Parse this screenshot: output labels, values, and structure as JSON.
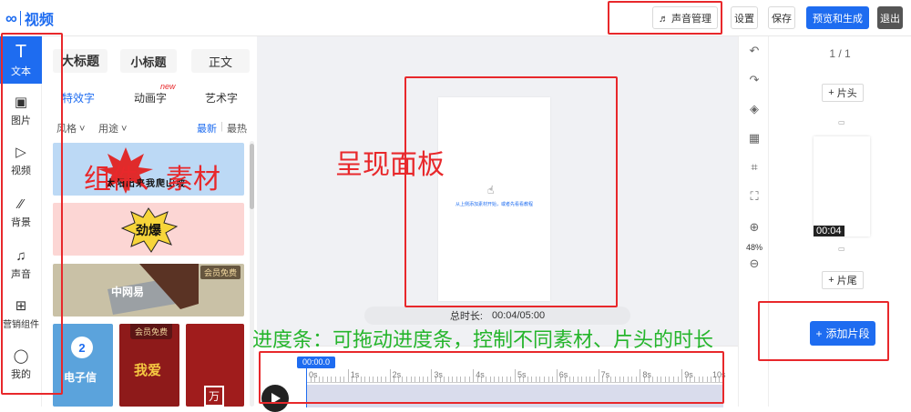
{
  "app": {
    "logo_mark": "∞",
    "logo_text": "视频"
  },
  "header": {
    "sound_button": "♬ 声音管理",
    "settings": "设置",
    "save": "保存",
    "preview": "预览和生成",
    "exit": "退出"
  },
  "nav": {
    "items": [
      {
        "label": "文本",
        "icon": "T"
      },
      {
        "label": "图片",
        "icon": "▣"
      },
      {
        "label": "视频",
        "icon": "▷"
      },
      {
        "label": "背景",
        "icon": "⁄⁄"
      },
      {
        "label": "声音",
        "icon": "♫"
      },
      {
        "label": "营销组件",
        "icon": "⊞"
      },
      {
        "label": "我的",
        "icon": "◯"
      }
    ]
  },
  "panel": {
    "title_tabs": [
      "大标题",
      "小标题",
      "正文"
    ],
    "subtabs": [
      "特效字",
      "动画字",
      "艺术字"
    ],
    "new_badge": "new",
    "filters": {
      "style": "风格 ˅",
      "usage": "用途 ˅",
      "latest": "最新",
      "hottest": "最热"
    },
    "cards": {
      "sun_text": "太阳出来我爬山坡",
      "boom": "劲爆",
      "member": "会员免费",
      "china": "中网易",
      "digit": "2",
      "electronic": "电子信",
      "wo_ai": "我爱",
      "wan": "万"
    }
  },
  "canvas": {
    "hint": "从上侧添加素材开始，或者先看看教程",
    "duration_label": "总时长:",
    "duration_value": "00:04/05:00"
  },
  "timeline": {
    "cursor": "00:00.0",
    "ticks": [
      "0s",
      "1s",
      "2s",
      "3s",
      "4s",
      "5s",
      "6s",
      "7s",
      "8s",
      "9s",
      "10s"
    ]
  },
  "tools": {
    "zoom": "48%"
  },
  "right": {
    "pager": "1 / 1",
    "add_head": "片头",
    "add_tail": "片尾",
    "thumb_time": "00:04",
    "add_segment": "添加片段"
  },
  "annotations": {
    "component": "组件、素材",
    "render_panel": "呈现面板",
    "progress": "进度条：可拖动进度条，控制不同素材、片头的时长"
  },
  "colors": {
    "accent": "#1e6cf0",
    "annotation_red": "#e8282b",
    "annotation_green": "#25b52b"
  }
}
